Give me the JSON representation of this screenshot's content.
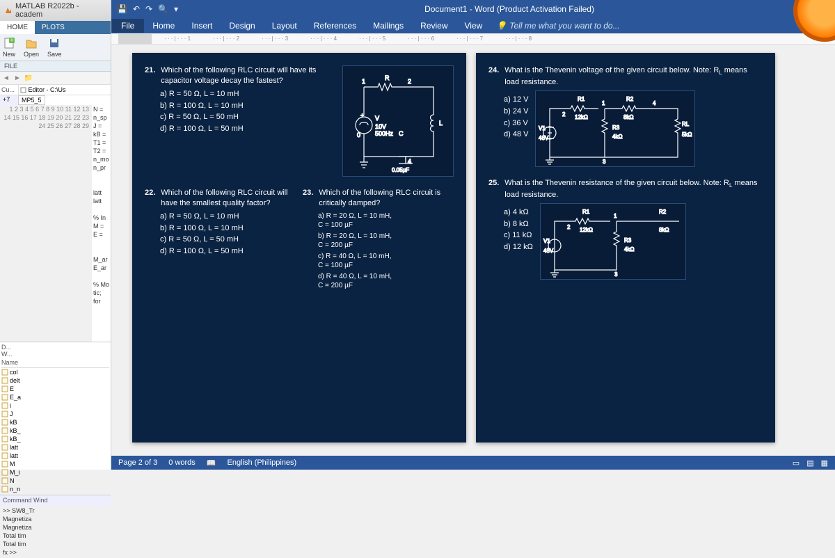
{
  "matlab": {
    "title": "MATLAB R2022b - academ",
    "tabs": [
      "HOME",
      "PLOTS"
    ],
    "toolstrip": {
      "new": "New",
      "open": "Open",
      "save": "Save"
    },
    "file_hdr": "FILE",
    "cur_label": "Cu...",
    "editor_path": "Editor - C:\\Us",
    "tab_name": "MP5_5",
    "plus": "+7",
    "code_lines": [
      "N =",
      "n_sp",
      "J =",
      "kB =",
      "T1 =",
      "T2 =",
      "n_mo",
      "n_pr",
      "",
      "",
      "latt",
      "latt",
      "",
      "% In",
      "M =",
      "E =",
      "",
      "",
      "M_ar",
      "E_ar",
      "",
      "% Mo",
      "tic;",
      "for",
      "",
      "",
      "",
      "",
      ""
    ],
    "gutter": [
      "1",
      "2",
      "3",
      "4",
      "5",
      "6",
      "7",
      "8",
      "9",
      "10",
      "11",
      "12",
      "13",
      "14",
      "15",
      "16",
      "17",
      "18",
      "19",
      "20",
      "21",
      "22",
      "23",
      "24",
      "25",
      "26",
      "27",
      "28",
      "29"
    ],
    "d_label": "D...",
    "w_label": "W...",
    "ws_name": "Name",
    "ws_vars": [
      "col",
      "delt",
      "E",
      "E_a",
      "i",
      "J",
      "kB",
      "kB_",
      "kB_",
      "latt",
      "latt",
      "M",
      "M_i",
      "N",
      "n_n"
    ],
    "cmd_title": "Command Wind",
    "cmd_lines": [
      ">> SW8_Tr",
      "Magnetiza",
      "Magnetiza",
      "Total tim",
      "Total tim"
    ],
    "prompt": "fx >>"
  },
  "word": {
    "title": "Document1 - Word (Product Activation Failed)",
    "menu": {
      "file": "File",
      "tabs": [
        "Home",
        "Insert",
        "Design",
        "Layout",
        "References",
        "Mailings",
        "Review",
        "View"
      ],
      "tell": "Tell me what you want to do..."
    },
    "ruler": [
      "1",
      "2",
      "3",
      "4",
      "5",
      "6",
      "7",
      "8"
    ],
    "status": {
      "page": "Page 2 of 3",
      "words": "0 words",
      "lang": "English (Philippines)"
    }
  },
  "q21": {
    "num": "21.",
    "stem": "Which of the following RLC circuit will have its capacitor voltage decay the fastest?",
    "opts": {
      "a": "a)   R = 50 Ω, L = 10 mH",
      "b": "b)   R = 100 Ω, L = 10 mH",
      "c": "c)   R = 50 Ω, L = 50 mH",
      "d": "d)   R = 100 Ω, L = 50 mH"
    },
    "circ": {
      "n1": "1",
      "n2": "2",
      "n4": "4",
      "n0": "0",
      "R": "R",
      "L": "L",
      "V": "V",
      "src": "10V",
      "freq": "500Hz",
      "cap": "0.05µF",
      "c": "C"
    }
  },
  "q22": {
    "num": "22.",
    "stem": "Which of the following RLC circuit will have the smallest quality factor?",
    "opts": {
      "a": "a)   R = 50 Ω, L = 10 mH",
      "b": "b)   R = 100 Ω, L = 10 mH",
      "c": "c)   R = 50 Ω, L = 50 mH",
      "d": "d)   R = 100 Ω, L = 50 mH"
    }
  },
  "q23": {
    "num": "23.",
    "stem": "Which of the following RLC circuit is critically damped?",
    "opts": {
      "a": "a)   R = 20 Ω, L = 10 mH,\n      C = 100 µF",
      "b": "b)   R = 20 Ω, L = 10 mH,\n      C = 200 µF",
      "c": "c)   R = 40 Ω, L = 10 mH,\n      C = 100 µF",
      "d": "d)   R = 40 Ω, L = 10 mH,\n      C = 200 µF"
    }
  },
  "q24": {
    "num": "24.",
    "stem": "What is the Thevenin voltage of the given circuit below. Note: R",
    "stem_sub": "L",
    "stem2": " means load resistance.",
    "opts": {
      "a": "a)   12 V",
      "b": "b)   24 V",
      "c": "c)   36 V",
      "d": "d)   48 V"
    },
    "circ": {
      "n1": "1",
      "n2": "2",
      "n3": "3",
      "n4": "4",
      "R1": "R1",
      "R2": "R2",
      "R3": "R3",
      "RL": "RL",
      "V1": "V1",
      "vv": "48V",
      "r1v": "12kΩ",
      "r2v": "8kΩ",
      "r3v": "4kΩ",
      "rlv": "5kΩ"
    }
  },
  "q25": {
    "num": "25.",
    "stem": "What is the Thevenin resistance of the given circuit below. Note: R",
    "stem_sub": "L",
    "stem2": " means load resistance.",
    "opts": {
      "a": "a)   4 kΩ",
      "b": "b)   8 kΩ",
      "c": "c)   11 kΩ",
      "d": "d)   12 kΩ"
    },
    "circ": {
      "n1": "1",
      "n2": "2",
      "n3": "3",
      "R1": "R1",
      "R2": "R2",
      "R3": "R3",
      "V1": "V1",
      "vv": "48V",
      "r1v": "12kΩ",
      "r2v": "8kΩ",
      "r3v": "4kΩ"
    }
  }
}
